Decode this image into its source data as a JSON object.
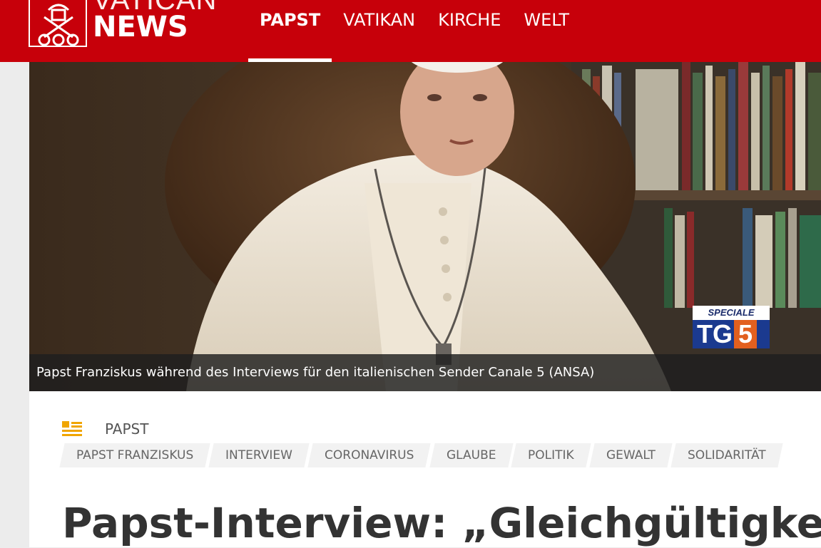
{
  "logo": {
    "top_word": "VATICAN",
    "bottom_word": "NEWS"
  },
  "nav": {
    "items": [
      {
        "label": "PAPST",
        "active": true
      },
      {
        "label": "VATIKAN",
        "active": false
      },
      {
        "label": "KIRCHE",
        "active": false
      },
      {
        "label": "WELT",
        "active": false
      }
    ]
  },
  "hero": {
    "caption": "Papst Franziskus während des Interviews für den italienischen Sender Canale 5  (ANSA)",
    "broadcaster_badge": {
      "top": "SPECIALE",
      "tg": "TG",
      "number": "5"
    }
  },
  "article": {
    "section_icon": "article-list-icon",
    "section": "PAPST",
    "tags": [
      "PAPST FRANZISKUS",
      "INTERVIEW",
      "CORONAVIRUS",
      "GLAUBE",
      "POLITIK",
      "GEWALT",
      "SOLIDARITÄT"
    ],
    "headline": "Papst-Interview: „Gleichgültigkeit"
  },
  "colors": {
    "brand_red": "#c7000a",
    "section_icon": "#f0a500",
    "tag_bg": "#f2f2f2",
    "headline": "#333333"
  }
}
